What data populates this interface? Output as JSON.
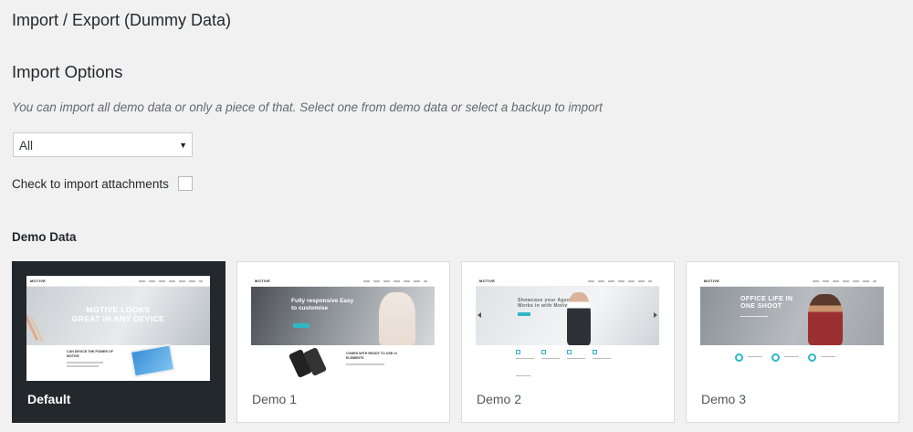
{
  "page": {
    "heading": "Import / Export (Dummy Data)"
  },
  "import_options": {
    "title": "Import Options",
    "description": "You can import all demo data or only a piece of that. Select one from demo data or select a backup to import",
    "select": {
      "selected": "All"
    },
    "attachments": {
      "label": "Check to import attachments",
      "checked": false
    }
  },
  "demo_data": {
    "title": "Demo Data",
    "selected": "Default",
    "items": [
      {
        "label": "Default",
        "thumb": {
          "logo": "MOTIVE",
          "headline_1": "MOTIVE LOOKS",
          "headline_2": "GREAT IN ANY DEVICE",
          "section_text": "CAN DEVICE THE POWER OF MOTIVE"
        }
      },
      {
        "label": "Demo 1",
        "thumb": {
          "logo": "MOTIVE",
          "headline_1": "Fully responsive Easy",
          "headline_2": "to customise",
          "section_text": "COMES WITH READY TO USE UI ELEMENTS"
        }
      },
      {
        "label": "Demo 2",
        "thumb": {
          "logo": "MOTIVE",
          "headline_1": "Showcase your Agency",
          "headline_2": "Works in with Motive WP"
        }
      },
      {
        "label": "Demo 3",
        "thumb": {
          "logo": "MOTIVE",
          "headline_1": "OFFICE LIFE IN",
          "headline_2": "ONE SHOOT"
        }
      }
    ]
  },
  "colors": {
    "background": "#f1f1f1",
    "selected_card": "#23282d",
    "accent": "#2fb7c3"
  }
}
